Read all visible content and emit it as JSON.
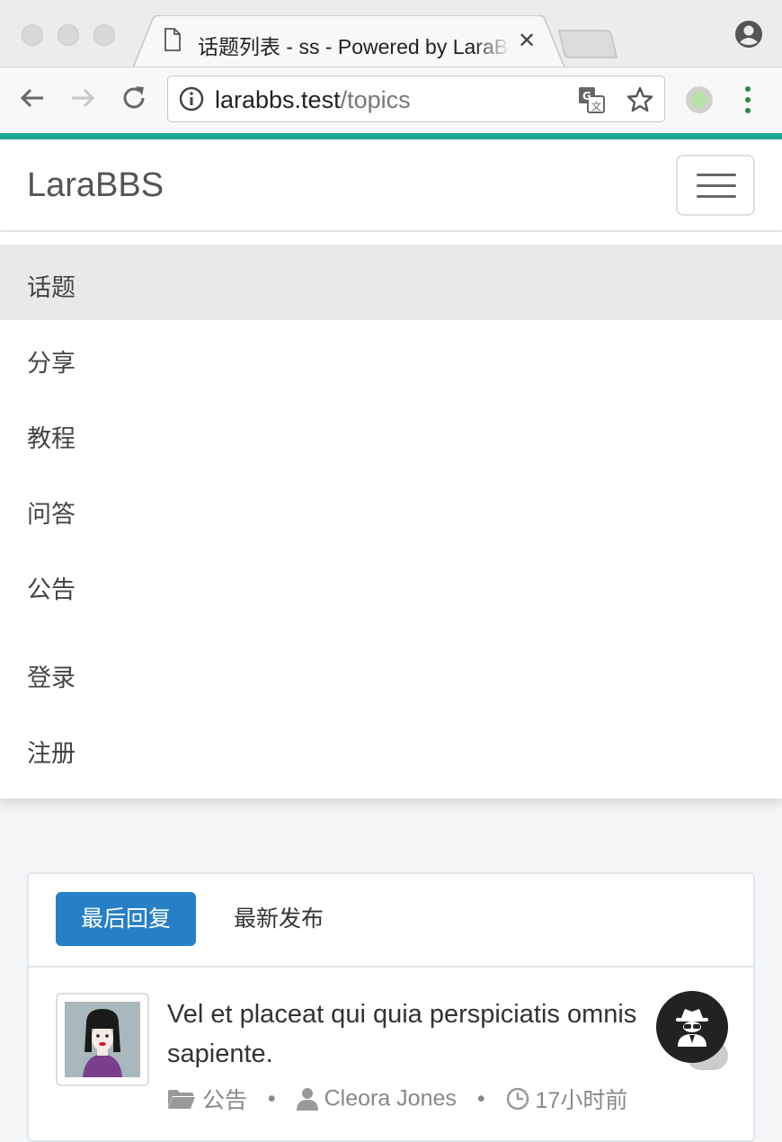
{
  "browser": {
    "tab_title": "话题列表 - ss - Powered by LaraBBS",
    "url_host": "larabbs.test",
    "url_path": "/topics"
  },
  "navbar": {
    "brand": "LaraBBS"
  },
  "menu": {
    "items": [
      {
        "label": "话题",
        "active": true
      },
      {
        "label": "分享",
        "active": false
      },
      {
        "label": "教程",
        "active": false
      },
      {
        "label": "问答",
        "active": false
      },
      {
        "label": "公告",
        "active": false
      }
    ],
    "auth": [
      {
        "label": "登录"
      },
      {
        "label": "注册"
      }
    ]
  },
  "topics": {
    "tabs": [
      {
        "label": "最后回复",
        "active": true
      },
      {
        "label": "最新发布",
        "active": false
      }
    ],
    "list": [
      {
        "title": "Vel et placeat qui quia perspiciatis omnis sapiente.",
        "category": "公告",
        "author": "Cleora Jones",
        "time": "17小时前"
      }
    ]
  },
  "colors": {
    "accent": "#1fa696",
    "primary": "#2780c7"
  },
  "icons": [
    "document-icon",
    "close-icon",
    "profile-icon",
    "back-arrow-icon",
    "forward-arrow-icon",
    "reload-icon",
    "info-icon",
    "translate-icon",
    "star-icon",
    "extension-icon",
    "menu-dots-icon",
    "hamburger-icon",
    "folder-icon",
    "user-icon",
    "clock-icon",
    "spy-icon"
  ]
}
